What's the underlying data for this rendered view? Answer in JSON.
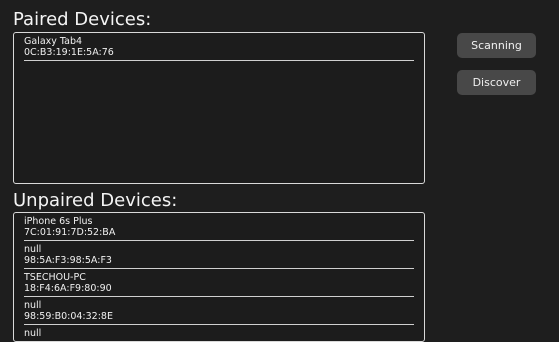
{
  "paired": {
    "title": "Paired Devices:",
    "devices": [
      {
        "name": "Galaxy Tab4",
        "address": "0C:B3:19:1E:5A:76"
      }
    ]
  },
  "unpaired": {
    "title": "Unpaired Devices:",
    "devices": [
      {
        "name": "iPhone 6s Plus",
        "address": "7C:01:91:7D:52:BA"
      },
      {
        "name": "null",
        "address": "98:5A:F3:98:5A:F3"
      },
      {
        "name": "TSECHOU-PC",
        "address": "18:F4:6A:F9:80:90"
      },
      {
        "name": "null",
        "address": "98:59:B0:04:32:8E"
      },
      {
        "name": "null",
        "address": ""
      }
    ]
  },
  "actions": {
    "scanning_label": "Scanning",
    "discover_label": "Discover"
  },
  "colors": {
    "background": "#1e1e1e",
    "button_bg": "#484848",
    "border": "#d9d9d9",
    "text": "#f2f2f2"
  }
}
